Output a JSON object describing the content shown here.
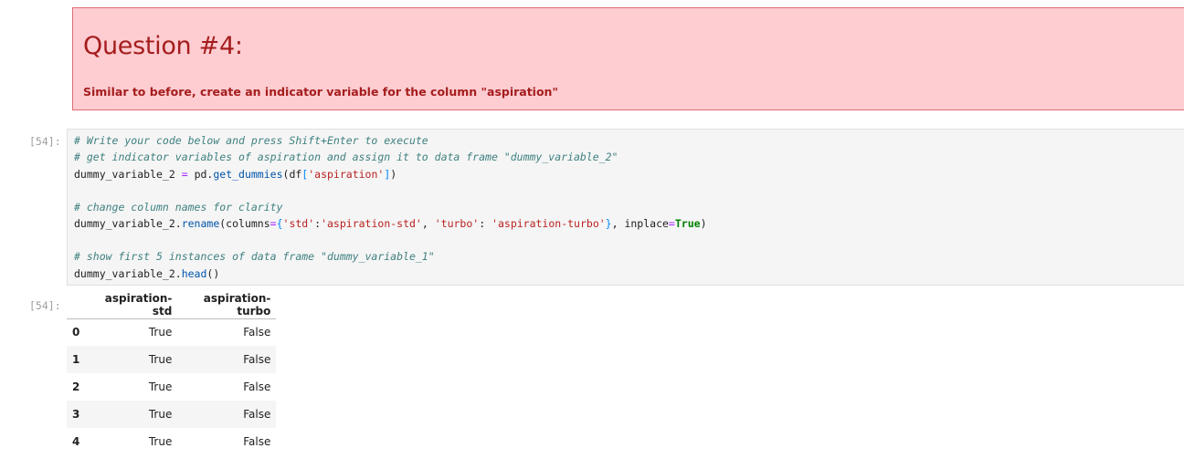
{
  "alert": {
    "title": "Question #4:",
    "text": "Similar to before, create an indicator variable for the column \"aspiration\""
  },
  "input_cell": {
    "prompt": "[54]:",
    "lines": {
      "c1": "# Write your code below and press Shift+Enter to execute",
      "c2": "# get indicator variables of aspiration and assign it to data frame \"dummy_variable_2\"",
      "l3_var": "dummy_variable_2 ",
      "l3_eq": "=",
      "l3_obj": " pd.",
      "l3_fn": "get_dummies",
      "l3_open": "(df",
      "l3_br1": "[",
      "l3_str": "'aspiration'",
      "l3_br2": "]",
      "l3_close": ")",
      "c4": "# change column names for clarity",
      "l5_var": "dummy_variable_2.",
      "l5_fn": "rename",
      "l5_a": "(columns",
      "l5_eq": "=",
      "l5_ob": "{",
      "l5_s1": "'std'",
      "l5_c1": ":",
      "l5_s2": "'aspiration-std'",
      "l5_c2": ", ",
      "l5_s3": "'turbo'",
      "l5_c3": ": ",
      "l5_s4": "'aspiration-turbo'",
      "l5_cb": "}",
      "l5_b": ", inplace",
      "l5_eq2": "=",
      "l5_kw": "True",
      "l5_end": ")",
      "c6": "# show first 5 instances of data frame \"dummy_variable_1\"",
      "l7_var": "dummy_variable_2.",
      "l7_fn": "head",
      "l7_end": "()"
    }
  },
  "output_cell": {
    "prompt": "[54]:",
    "columns": [
      "",
      "aspiration-std",
      "aspiration-turbo"
    ],
    "rows": [
      {
        "index": "0",
        "std": "True",
        "turbo": "False"
      },
      {
        "index": "1",
        "std": "True",
        "turbo": "False"
      },
      {
        "index": "2",
        "std": "True",
        "turbo": "False"
      },
      {
        "index": "3",
        "std": "True",
        "turbo": "False"
      },
      {
        "index": "4",
        "std": "True",
        "turbo": "False"
      }
    ]
  }
}
